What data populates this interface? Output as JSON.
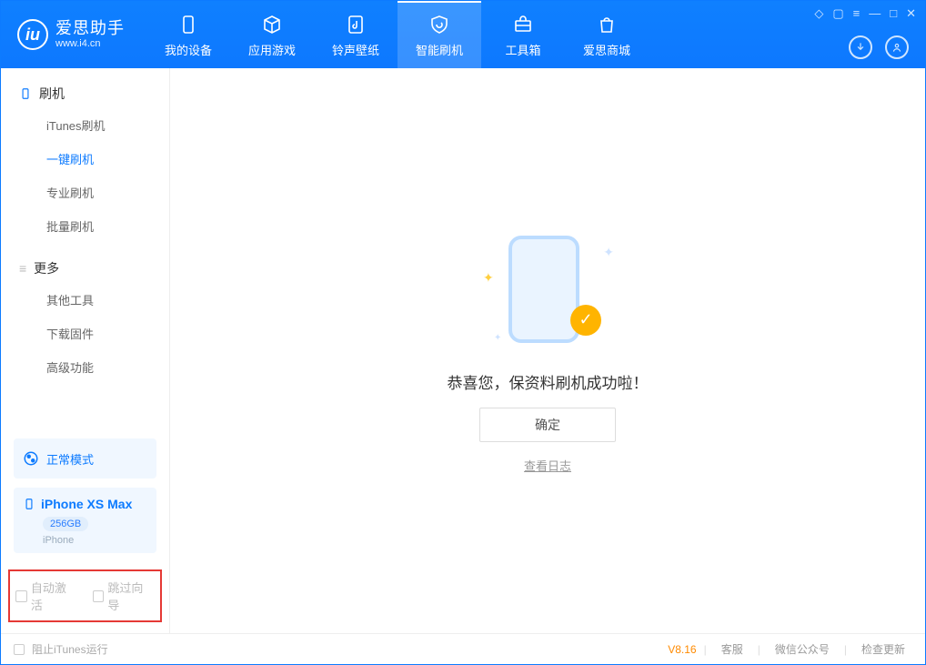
{
  "logo": {
    "cn": "爱思助手",
    "en": "www.i4.cn",
    "mark": "iu"
  },
  "tabs": [
    {
      "id": "device",
      "label": "我的设备"
    },
    {
      "id": "apps",
      "label": "应用游戏"
    },
    {
      "id": "rings",
      "label": "铃声壁纸"
    },
    {
      "id": "flash",
      "label": "智能刷机"
    },
    {
      "id": "toolbox",
      "label": "工具箱"
    },
    {
      "id": "store",
      "label": "爱思商城"
    }
  ],
  "sidebar": {
    "groups": [
      {
        "id": "flash",
        "title": "刷机",
        "items": [
          {
            "id": "itunes",
            "label": "iTunes刷机"
          },
          {
            "id": "onekey",
            "label": "一键刷机",
            "active": true
          },
          {
            "id": "pro",
            "label": "专业刷机"
          },
          {
            "id": "batch",
            "label": "批量刷机"
          }
        ]
      },
      {
        "id": "more",
        "title": "更多",
        "items": [
          {
            "id": "other",
            "label": "其他工具"
          },
          {
            "id": "fw",
            "label": "下载固件"
          },
          {
            "id": "adv",
            "label": "高级功能"
          }
        ]
      }
    ],
    "status": {
      "label": "正常模式"
    },
    "device": {
      "name": "iPhone XS Max",
      "capacity": "256GB",
      "type": "iPhone"
    },
    "opts": {
      "auto": "自动激活",
      "skip": "跳过向导"
    }
  },
  "main": {
    "message": "恭喜您，保资料刷机成功啦！",
    "ok": "确定",
    "viewlog": "查看日志"
  },
  "footer": {
    "block": "阻止iTunes运行",
    "ver": "V8.16",
    "links": [
      "客服",
      "微信公众号",
      "检查更新"
    ]
  }
}
